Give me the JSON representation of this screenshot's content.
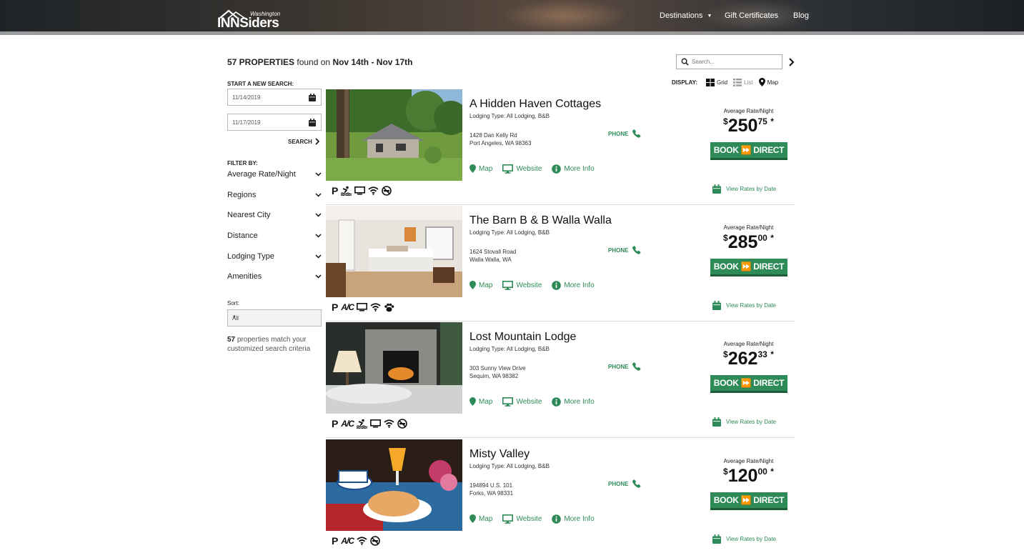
{
  "header": {
    "logo_small": "Washington",
    "logo_brand": "INNSiders",
    "nav": [
      {
        "label": "Destinations"
      },
      {
        "label": "Gift Certificates"
      },
      {
        "label": "Blog"
      }
    ]
  },
  "summary": {
    "count": "57 PROPERTIES",
    "found_on": "found on",
    "range": "Nov 14th - Nov 17th"
  },
  "search": {
    "placeholder": "Search..."
  },
  "display": {
    "label": "DISPLAY:",
    "options": [
      "Grid",
      "List",
      "Map"
    ]
  },
  "sidebar": {
    "new_search_label": "START A NEW SEARCH:",
    "start_date": "11/14/2019",
    "end_date": "11/17/2019",
    "search_label": "SEARCH",
    "filter_label": "FILTER BY:",
    "filters": [
      "Average Rate/Night",
      "Regions",
      "Nearest City",
      "Distance",
      "Lodging Type",
      "Amenities"
    ],
    "sort_label": "Sort:",
    "sort_value": "All",
    "match_count": "57",
    "match_text": "properties match your customized search criteria"
  },
  "common": {
    "phone": "PHONE",
    "map": "Map",
    "website": "Website",
    "more_info": "More Info",
    "rate_label": "Average Rate/Night",
    "book": "BOOK ⏩ DIRECT",
    "view_rates": "View Rates by Date",
    "currency": "$",
    "star": "*"
  },
  "colors": {
    "accent": "#2e8b57",
    "accent_dark": "#1d5e3a"
  },
  "listings": [
    {
      "name": "A Hidden Haven Cottages",
      "type": "Lodging Type: All Lodging, B&B",
      "addr1": "1428 Dan Kelly Rd",
      "addr2": "Port Angeles, WA 98363",
      "price": "250",
      "cents": "75",
      "amenities": [
        "parking-icon",
        "pool-icon",
        "tv-icon",
        "wifi-icon",
        "no-smoking-icon"
      ]
    },
    {
      "name": "The Barn B & B Walla Walla",
      "type": "Lodging Type: All Lodging, B&B",
      "addr1": "1624 Stovall Road",
      "addr2": "Walla Walla, WA",
      "price": "285",
      "cents": "00",
      "amenities": [
        "parking-icon",
        "ac-icon",
        "tv-icon",
        "wifi-icon",
        "pets-icon"
      ]
    },
    {
      "name": "Lost Mountain Lodge",
      "type": "Lodging Type: All Lodging, B&B",
      "addr1": "303 Sunny View Drive",
      "addr2": "Sequim, WA 98382",
      "price": "262",
      "cents": "33",
      "amenities": [
        "parking-icon",
        "ac-icon",
        "pool-icon",
        "tv-icon",
        "wifi-icon",
        "no-smoking-icon"
      ]
    },
    {
      "name": "Misty Valley",
      "type": "Lodging Type: All Lodging, B&B",
      "addr1": "194894 U.S. 101",
      "addr2": "Forks, WA 98331",
      "price": "120",
      "cents": "00",
      "amenities": [
        "parking-icon",
        "ac-icon",
        "wifi-icon",
        "no-smoking-icon"
      ]
    }
  ]
}
